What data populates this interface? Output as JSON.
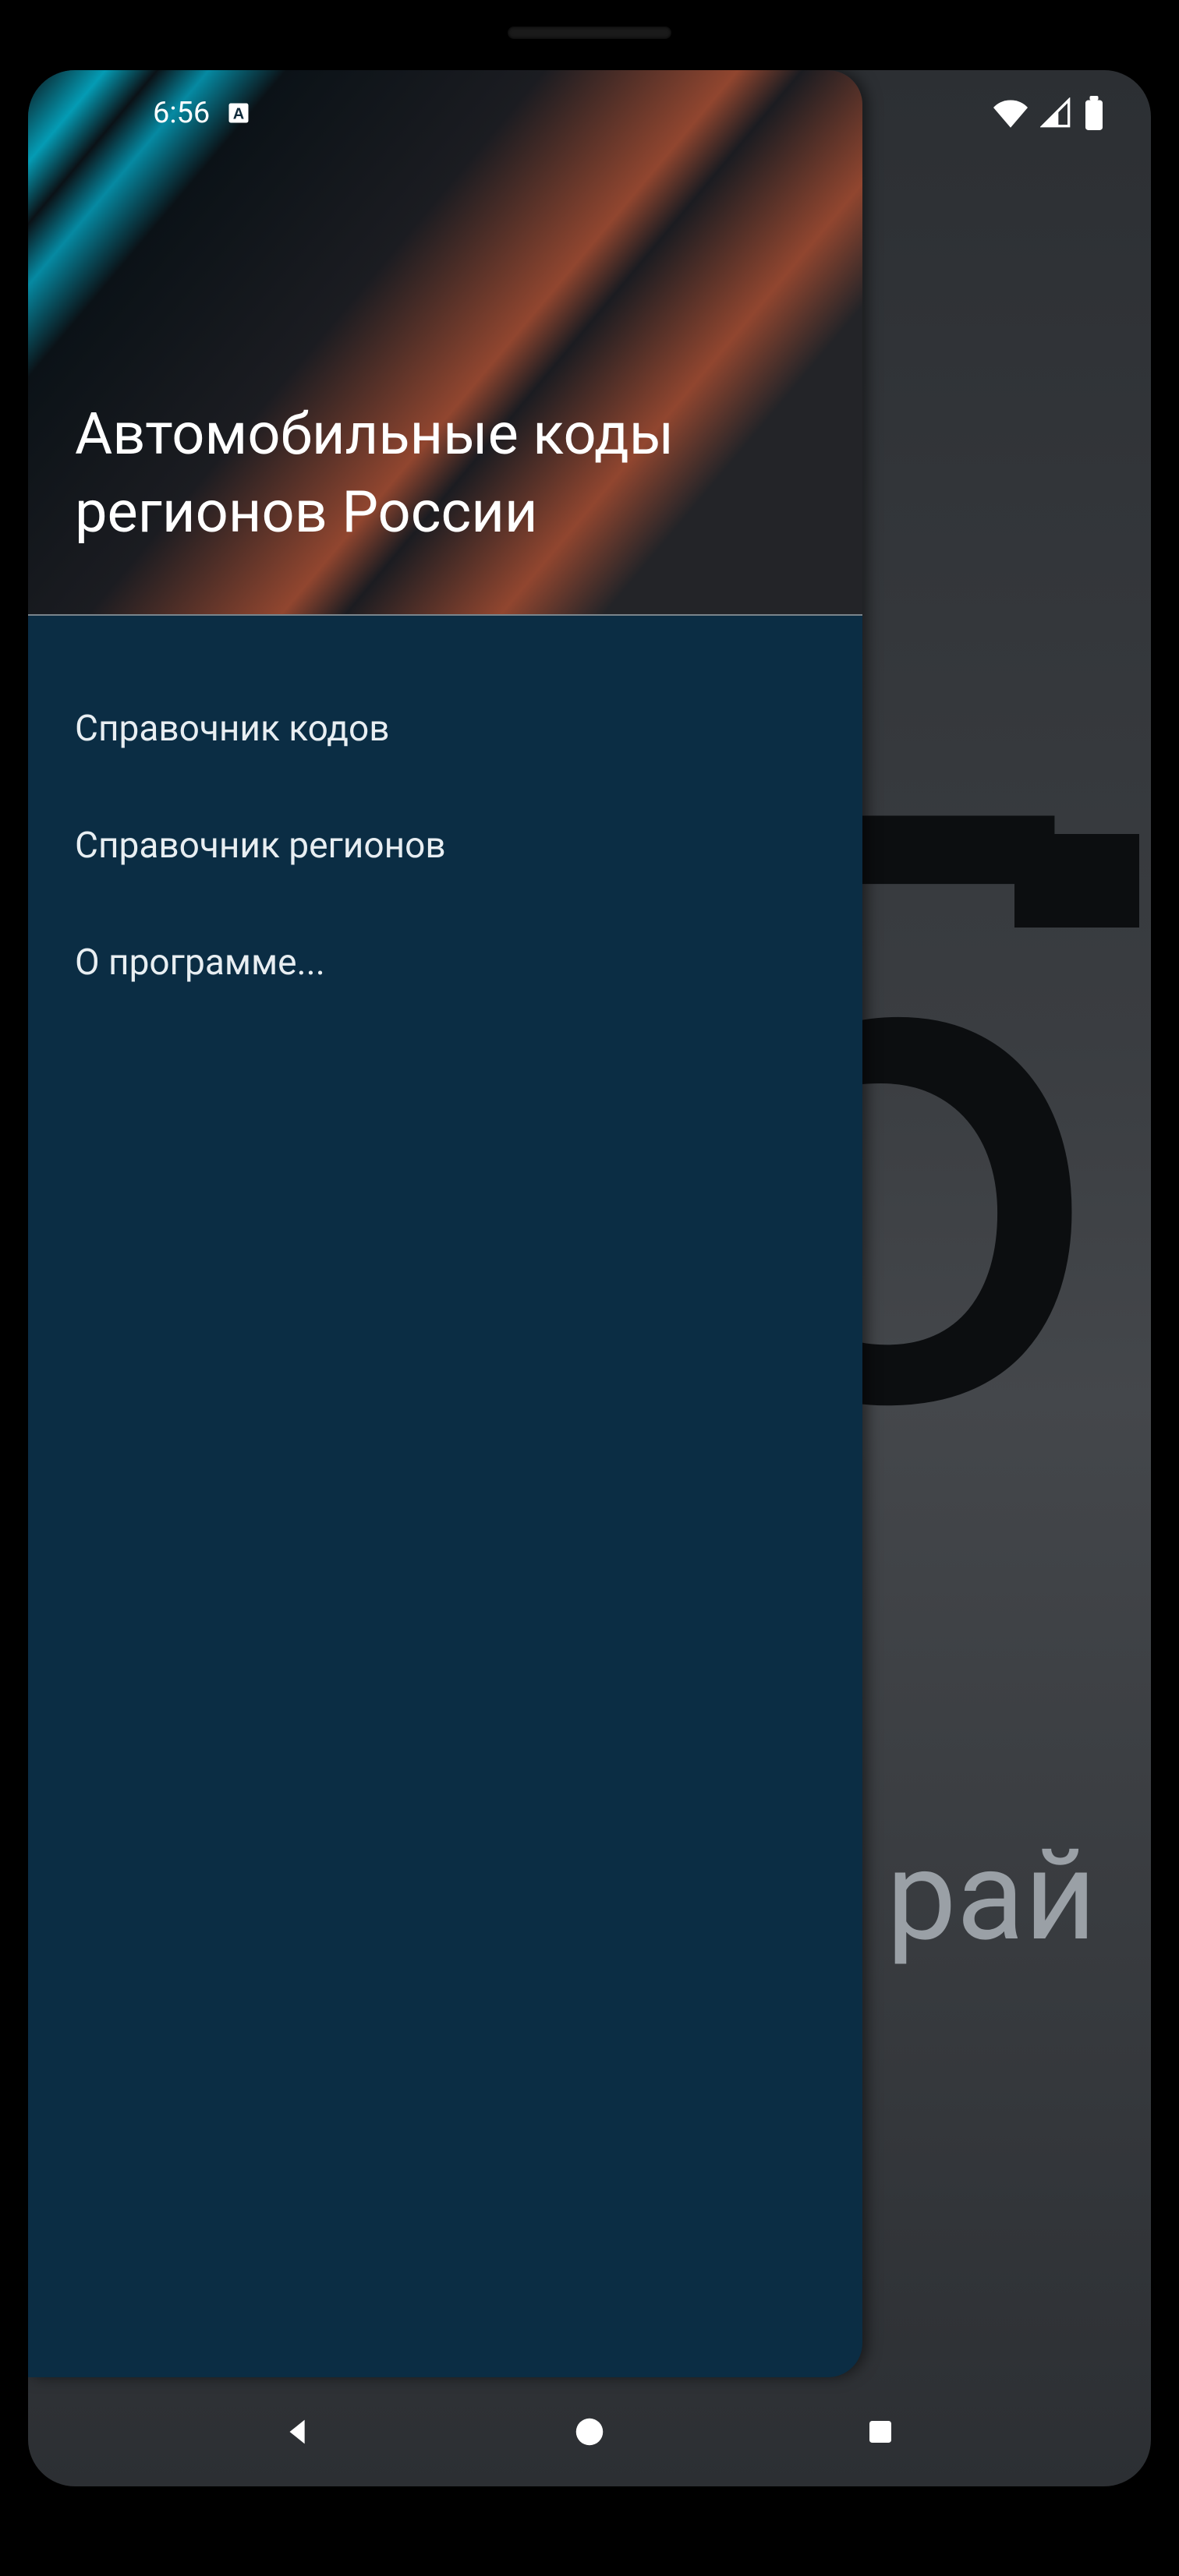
{
  "statusbar": {
    "time": "6:56",
    "input_indicator": "A"
  },
  "backdrop": {
    "partial_digit": "5",
    "partial_text": "рай"
  },
  "drawer": {
    "title": "Автомобильные коды регионов России",
    "menu": [
      {
        "label": "Справочник кодов"
      },
      {
        "label": "Справочник регионов"
      },
      {
        "label": "О программе..."
      }
    ]
  }
}
